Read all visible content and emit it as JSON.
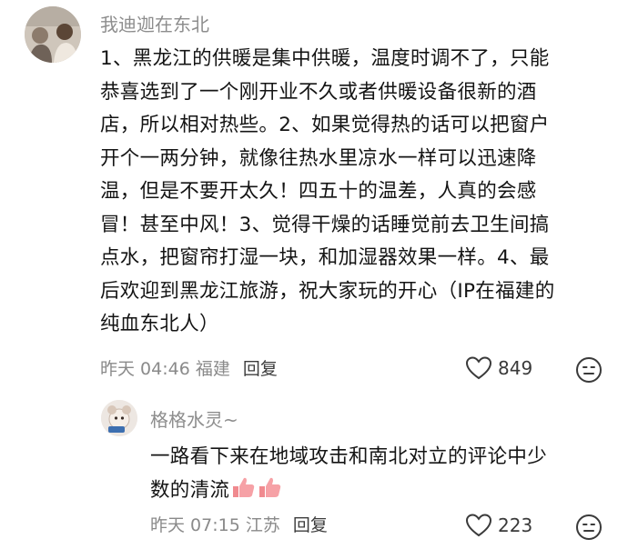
{
  "comment": {
    "author": "我迪迦在东北",
    "lines": [
      "1、黑龙江的供暖是集中供暖，温度时调不了，只能",
      "恭喜选到了一个刚开业不久或者供暖设备很新的酒",
      "店，所以相对热些。2、如果觉得热的话可以把窗户",
      "开个一两分钟，就像往热水里凉水一样可以迅速降",
      "温，但是不要开太久！四五十的温差，人真的会感",
      "冒！甚至中风！3、觉得干燥的话睡觉前去卫生间搞",
      "点水，把窗帘打湿一块，和加湿器效果一样。4、最",
      "后欢迎到黑龙江旅游，祝大家玩的开心（IP在福建的",
      "纯血东北人）"
    ],
    "meta": "昨天 04:46 福建",
    "reply_label": "回复",
    "likes": "849"
  },
  "reply": {
    "author": "格格水灵~",
    "lines": [
      "一路看下来在地域攻击和南北对立的评论中少",
      "数的清流"
    ],
    "meta": "昨天 07:15 江苏",
    "reply_label": "回复",
    "likes": "223"
  },
  "icons": {
    "like": "heart-outline-icon",
    "reaction": "emoji-face-icon",
    "hand": "thumbs-up-emoji"
  },
  "colors": {
    "text": "#141414",
    "muted": "#8d8d8d",
    "hand": "#f08a8f"
  }
}
